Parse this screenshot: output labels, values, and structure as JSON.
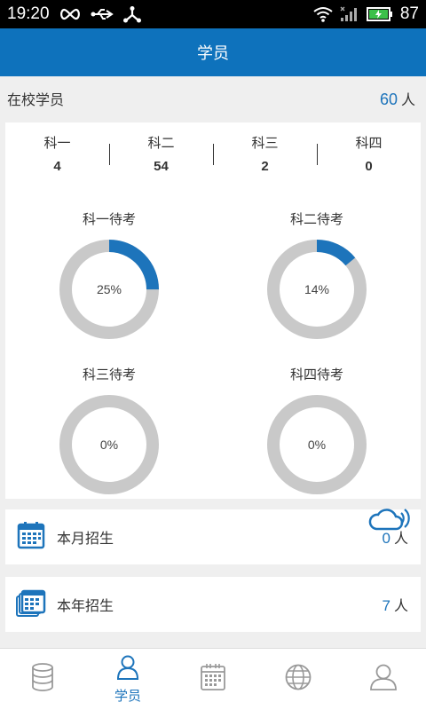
{
  "status_bar": {
    "time": "19:20",
    "battery": "87",
    "icons": [
      "infinity-icon",
      "usb-icon",
      "share-icon",
      "wifi-icon",
      "signal-icon",
      "battery-icon"
    ]
  },
  "header": {
    "title": "学员"
  },
  "summary": {
    "label": "在校学员",
    "count": "60",
    "unit": "人"
  },
  "subjects": [
    {
      "label": "科一",
      "value": "4"
    },
    {
      "label": "科二",
      "value": "54"
    },
    {
      "label": "科三",
      "value": "2"
    },
    {
      "label": "科四",
      "value": "0"
    }
  ],
  "pending": [
    {
      "title": "科一待考",
      "percent_text": "25%",
      "percent": 25
    },
    {
      "title": "科二待考",
      "percent_text": "14%",
      "percent": 14
    },
    {
      "title": "科三待考",
      "percent_text": "0%",
      "percent": 0
    },
    {
      "title": "科四待考",
      "percent_text": "0%",
      "percent": 0
    }
  ],
  "enroll_month": {
    "label": "本月招生",
    "count": "0",
    "unit": "人"
  },
  "enroll_year": {
    "label": "本年招生",
    "count": "7",
    "unit": "人"
  },
  "tabbar": {
    "items": [
      {
        "icon": "database-icon",
        "label": "",
        "active": false
      },
      {
        "icon": "person-icon",
        "label": "学员",
        "active": true
      },
      {
        "icon": "calendar-icon",
        "label": "",
        "active": false
      },
      {
        "icon": "globe-icon",
        "label": "",
        "active": false
      },
      {
        "icon": "user-icon",
        "label": "",
        "active": false
      }
    ]
  },
  "colors": {
    "accent": "#1d74bb",
    "header": "#0e72bc",
    "donut_track": "#c9c9c9",
    "donut_fill": "#1d74bb"
  }
}
